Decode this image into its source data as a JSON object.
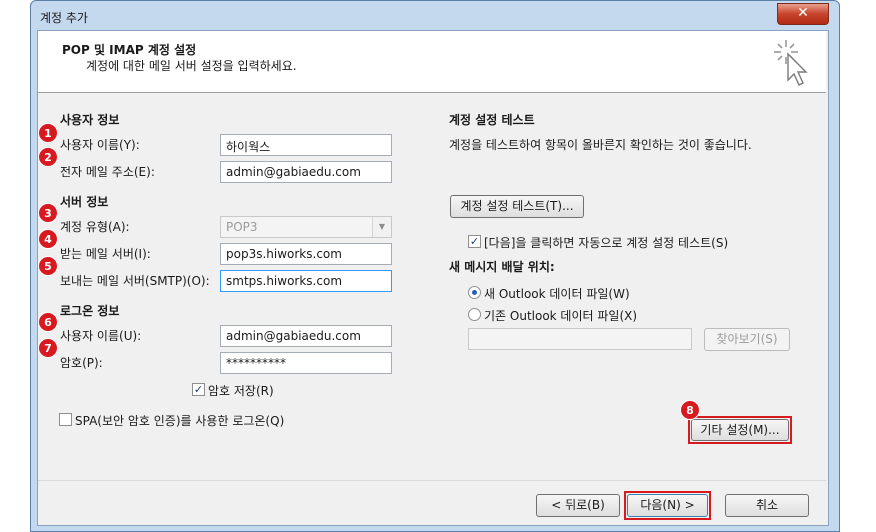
{
  "window": {
    "title": "계정 추가",
    "close_glyph": "✕"
  },
  "header": {
    "title": "POP 및 IMAP 계정 설정",
    "subtitle": "계정에 대한 메일 서버 설정을 입력하세요."
  },
  "user_info": {
    "heading": "사용자 정보",
    "name_label": "사용자 이름(Y):",
    "name_value": "하이웍스",
    "email_label": "전자 메일 주소(E):",
    "email_value": "admin@gabiaedu.com"
  },
  "server_info": {
    "heading": "서버 정보",
    "type_label": "계정 유형(A):",
    "type_value": "POP3",
    "incoming_label": "받는 메일 서버(I):",
    "incoming_value": "pop3s.hiworks.com",
    "outgoing_label": "보내는 메일 서버(SMTP)(O):",
    "outgoing_value": "smtps.hiworks.com"
  },
  "logon_info": {
    "heading": "로그온 정보",
    "user_label": "사용자 이름(U):",
    "user_value": "admin@gabiaedu.com",
    "password_label": "암호(P):",
    "password_value": "**********",
    "remember_label": "암호 저장(R)",
    "remember_checked": true,
    "spa_label": "SPA(보안 암호 인증)를 사용한 로그온(Q)",
    "spa_checked": false
  },
  "test": {
    "heading": "계정 설정 테스트",
    "description": "계정을 테스트하여 항목이 올바른지 확인하는 것이 좋습니다.",
    "button": "계정 설정 테스트(T)...",
    "auto_label": "[다음]을 클릭하면 자동으로 계정 설정 테스트(S)",
    "auto_checked": true
  },
  "delivery": {
    "heading": "새 메시지 배달 위치:",
    "new_file_label": "새 Outlook 데이터 파일(W)",
    "existing_file_label": "기존 Outlook 데이터 파일(X)",
    "path_value": "",
    "browse_button": "찾아보기(S)"
  },
  "more_settings_button": "기타 설정(M)...",
  "footer": {
    "back_button": "< 뒤로(B)",
    "next_button": "다음(N) >",
    "cancel_button": "취소"
  },
  "callouts": [
    "1",
    "2",
    "3",
    "4",
    "5",
    "6",
    "7",
    "8"
  ],
  "colors": {
    "callout": "#d71920",
    "frame": "#c4d8ee"
  }
}
